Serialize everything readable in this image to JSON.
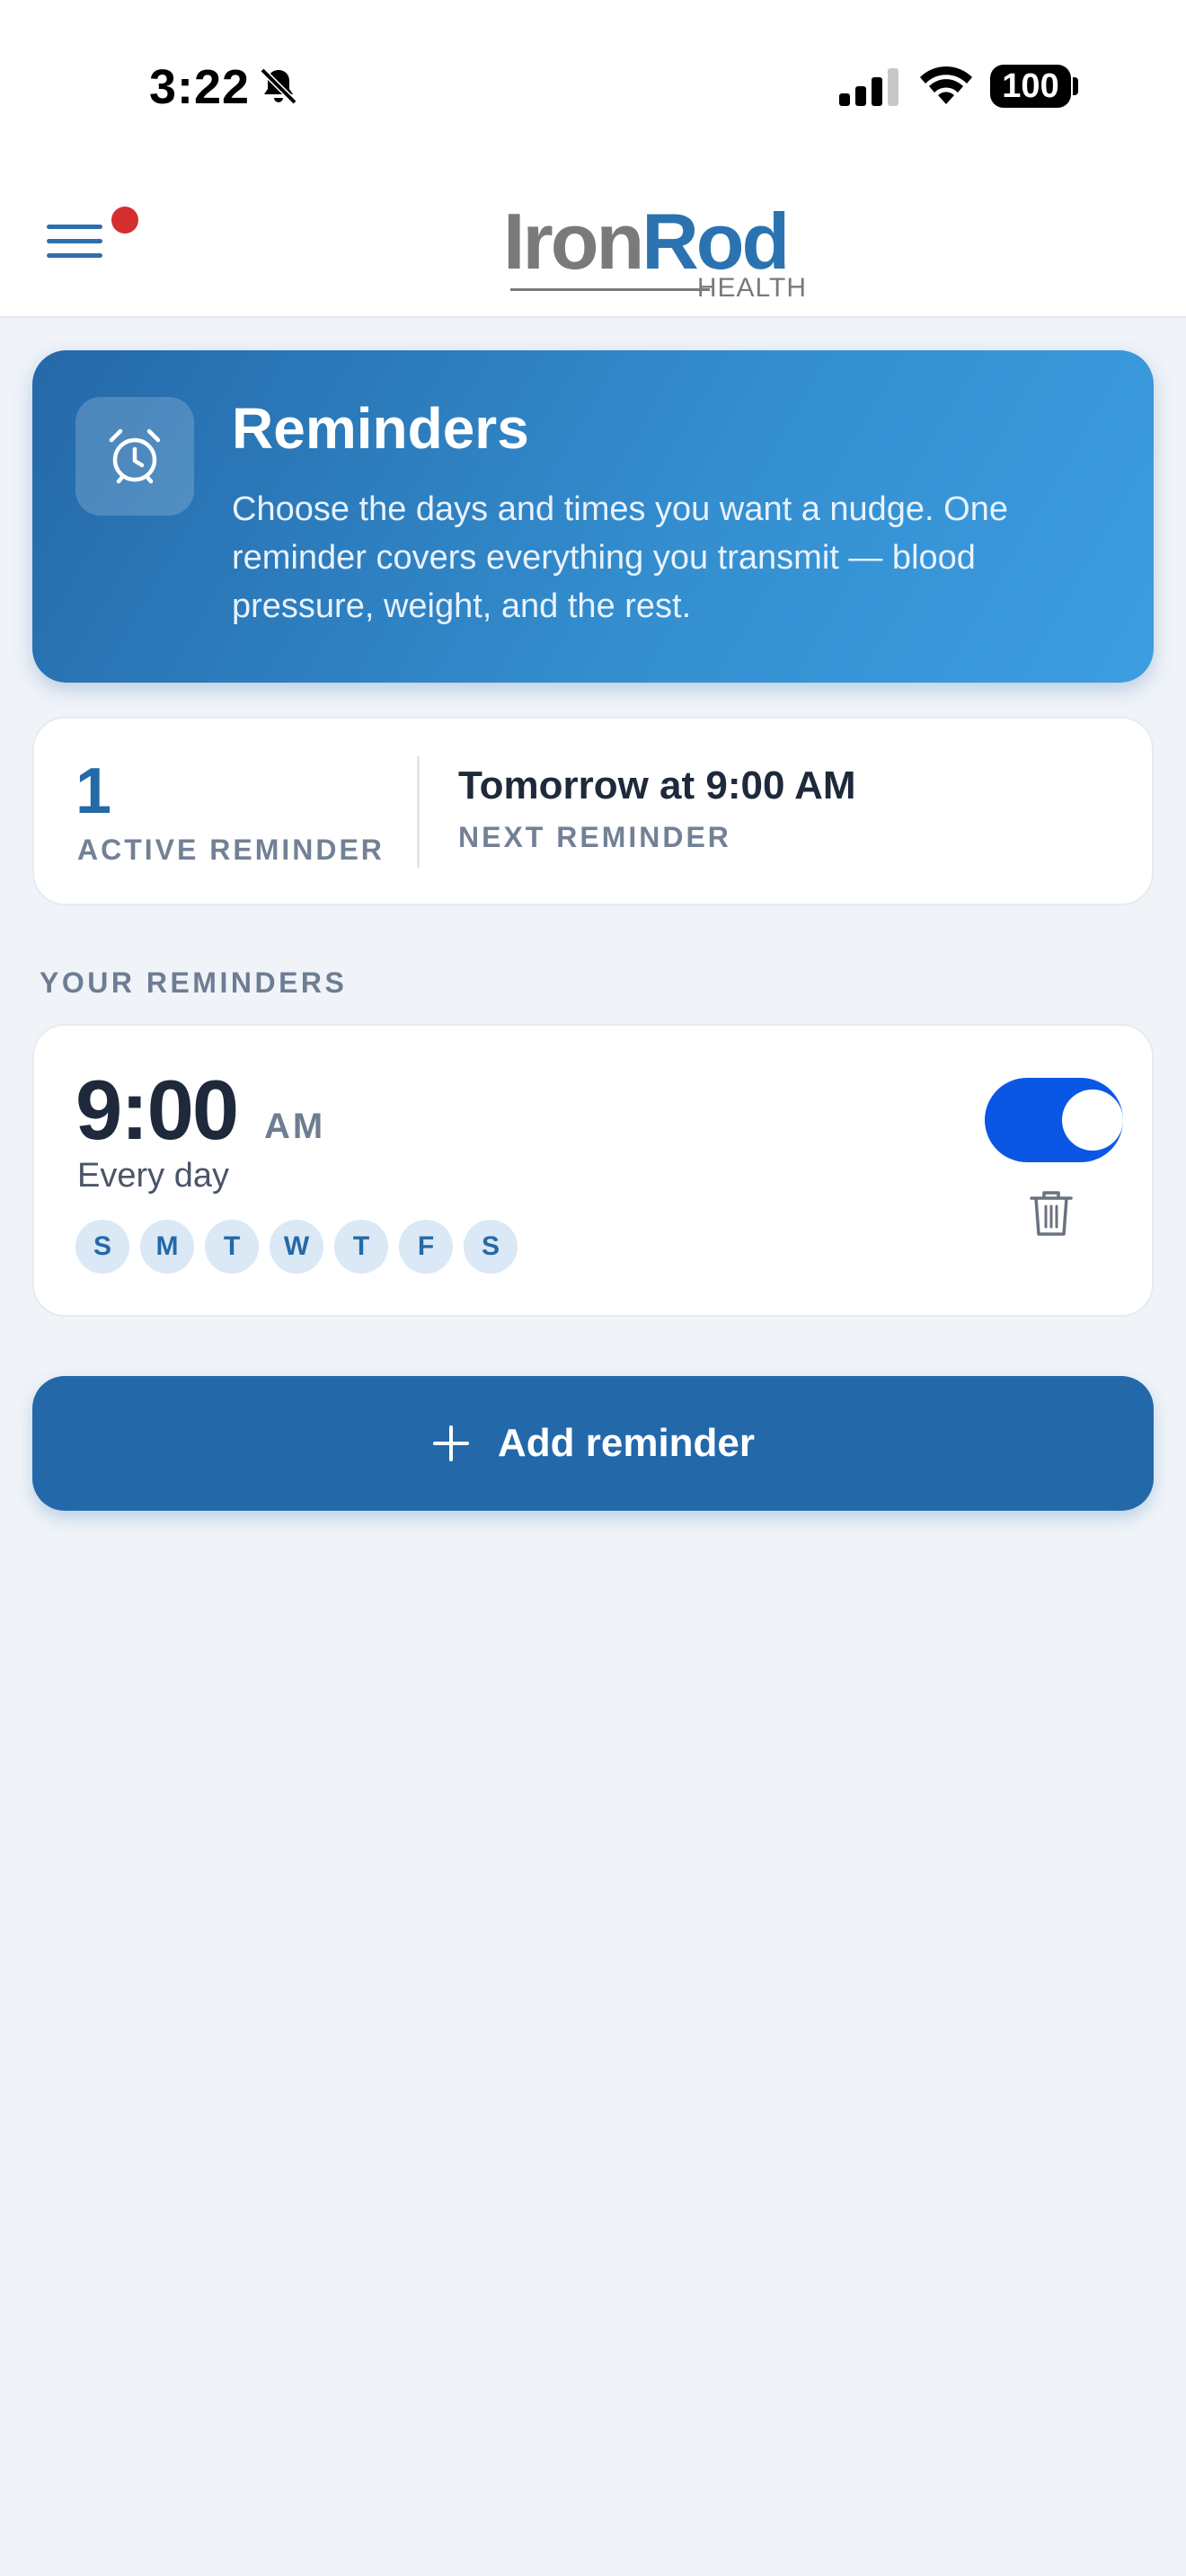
{
  "status_bar": {
    "time": "3:22",
    "battery": "100"
  },
  "header": {
    "logo_iron": "Iron",
    "logo_rod": "Rod",
    "logo_sub": "HEALTH"
  },
  "hero": {
    "title": "Reminders",
    "description": "Choose the days and times you want a nudge. One reminder covers everything you transmit — blood pressure, weight, and the rest."
  },
  "stats": {
    "active_count": "1",
    "active_label": "ACTIVE REMINDER",
    "next_value": "Tomorrow at 9:00 AM",
    "next_label": "NEXT REMINDER"
  },
  "section": {
    "label": "YOUR REMINDERS"
  },
  "reminders": [
    {
      "time": "9:00",
      "ampm": "AM",
      "frequency": "Every day",
      "days": [
        "S",
        "M",
        "T",
        "W",
        "T",
        "F",
        "S"
      ],
      "enabled": true
    }
  ],
  "actions": {
    "add_label": "Add reminder"
  },
  "colors": {
    "primary": "#2369aa",
    "toggle_on": "#0a57e6",
    "badge": "#d32f2f",
    "background": "#f0f4f9"
  }
}
